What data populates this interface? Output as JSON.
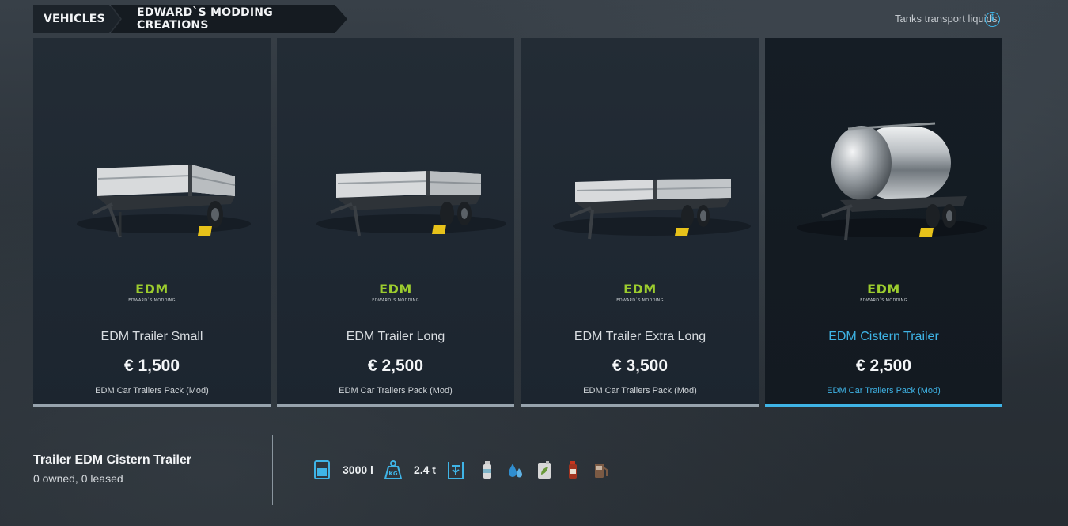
{
  "breadcrumb": [
    "VEHICLES",
    "EDWARD`S MODDING CREATIONS"
  ],
  "hint": "Tanks transport liquids.",
  "cards": [
    {
      "brand": "EDM",
      "brand_sub": "EDWARD`S MODDING",
      "title": "EDM Trailer Small",
      "price": "€ 1,500",
      "mod": "EDM Car Trailers Pack (Mod)",
      "selected": false,
      "image": "flatbed-trailer-small"
    },
    {
      "brand": "EDM",
      "brand_sub": "EDWARD`S MODDING",
      "title": "EDM Trailer Long",
      "price": "€ 2,500",
      "mod": "EDM Car Trailers Pack (Mod)",
      "selected": false,
      "image": "flatbed-trailer-long"
    },
    {
      "brand": "EDM",
      "brand_sub": "EDWARD`S MODDING",
      "title": "EDM Trailer Extra Long",
      "price": "€ 3,500",
      "mod": "EDM Car Trailers Pack (Mod)",
      "selected": false,
      "image": "flatbed-trailer-extra-long"
    },
    {
      "brand": "EDM",
      "brand_sub": "EDWARD`S MODDING",
      "title": "EDM Cistern Trailer",
      "price": "€ 2,500",
      "mod": "EDM Car Trailers Pack (Mod)",
      "selected": true,
      "image": "cistern-trailer"
    }
  ],
  "details": {
    "title": "Trailer EDM Cistern Trailer",
    "ownership": "0 owned, 0 leased",
    "capacity": "3000 l",
    "weight": "2.4 t",
    "attribute_icons": [
      "capacity-icon",
      "weight-icon",
      "fill-type-icon"
    ],
    "fill_types": [
      "liquid-fertilizer-icon",
      "water-icon",
      "herbicide-icon",
      "milk-bottle-icon",
      "fuel-icon"
    ]
  },
  "colors": {
    "accent": "#3fb4e6",
    "brand_green": "#9ccc2e",
    "card_bar": "#97a3ad"
  }
}
